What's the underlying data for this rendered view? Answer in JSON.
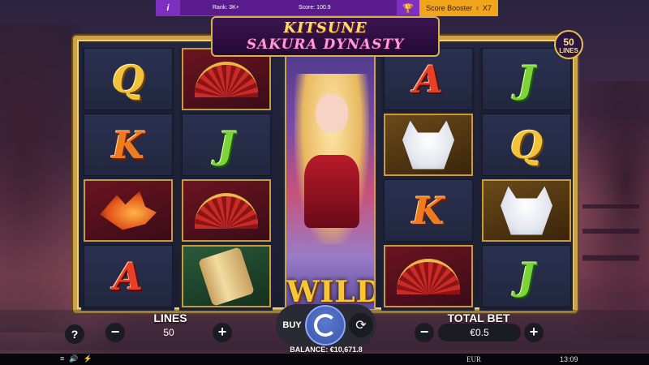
{
  "topbar": {
    "info_icon": "i",
    "rank_label": "Rank: 3K+",
    "score_label": "Score: 100.9",
    "trophy_icon": "trophy-icon",
    "booster_label": "Score Booster",
    "booster_multiplier": "X7"
  },
  "game": {
    "title_line1": "KITSUNE",
    "title_line2": "SAKURA DYNASTY",
    "lines_badge_number": "50",
    "lines_badge_label": "LINES",
    "wild_label": "WILD"
  },
  "reels": [
    [
      "Q",
      "K",
      "fox",
      "A"
    ],
    [
      "fan",
      "J",
      "fan",
      "scroll"
    ],
    [
      "wild",
      "wild",
      "wild",
      "wild"
    ],
    [
      "A",
      "mask",
      "K",
      "fan"
    ],
    [
      "J",
      "Q",
      "mask",
      "J"
    ]
  ],
  "controls": {
    "help_label": "?",
    "lines_title": "LINES",
    "lines_value": "50",
    "minus_label": "−",
    "plus_label": "+",
    "buy_label": "BUY",
    "total_bet_title": "TOTAL BET",
    "total_bet_value": "€0.5",
    "balance_label": "BALANCE: €10,671.8"
  },
  "system": {
    "menu_icon": "≡",
    "sound_icon": "🔊",
    "turbo_icon": "⚡",
    "currency": "EUR",
    "time": "13:09"
  },
  "colors": {
    "topbar": "#5a1b8e",
    "booster": "#f1a51b",
    "frame_gold": "#c9a24a",
    "spin_blue": "#3a56a8"
  }
}
